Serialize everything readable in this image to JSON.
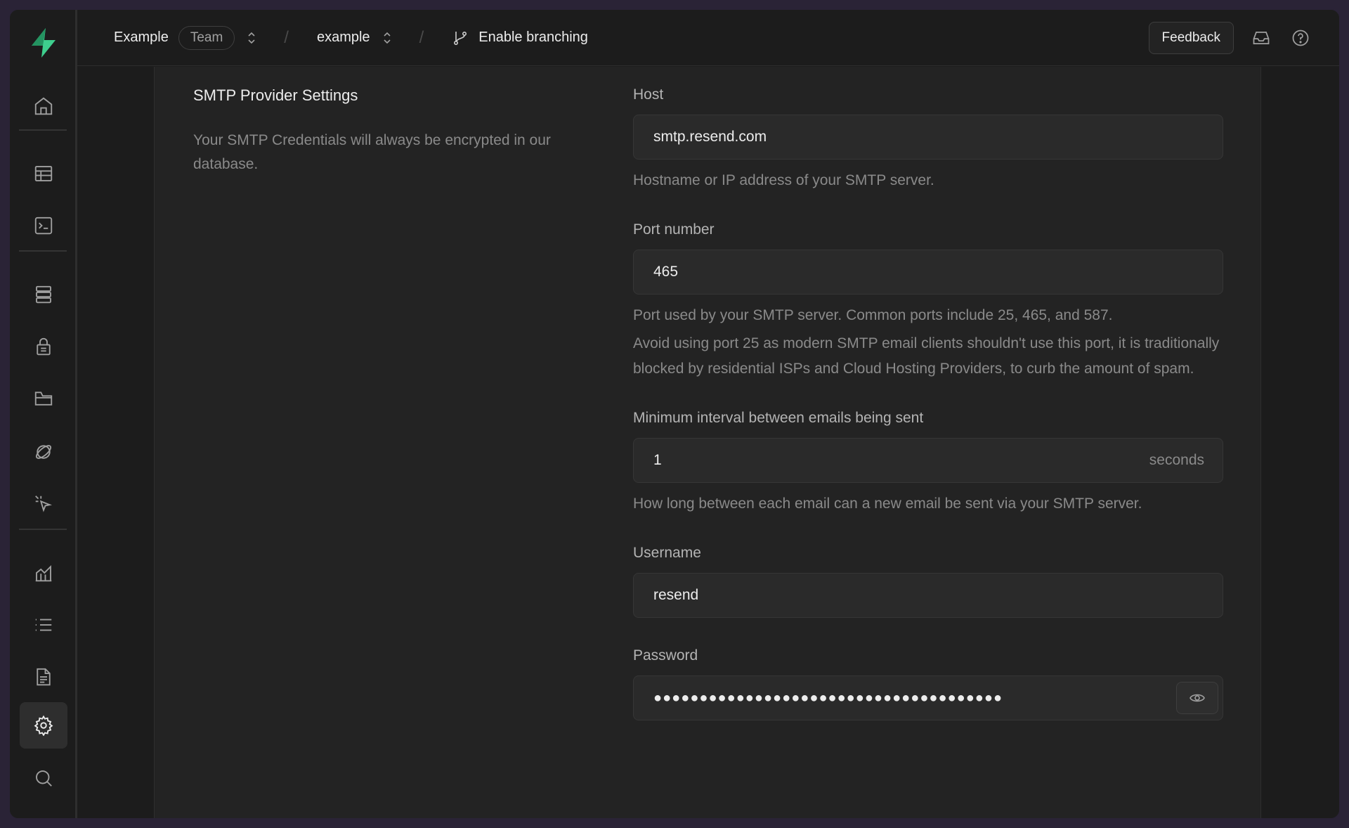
{
  "header": {
    "org_name": "Example",
    "org_badge": "Team",
    "project_name": "example",
    "branching_label": "Enable branching",
    "feedback_label": "Feedback"
  },
  "sidebar": {
    "items": [
      {
        "icon": "home-icon"
      },
      {
        "icon": "table-editor-icon"
      },
      {
        "icon": "sql-editor-icon"
      },
      {
        "icon": "database-icon"
      },
      {
        "icon": "authentication-icon"
      },
      {
        "icon": "storage-icon"
      },
      {
        "icon": "realtime-icon"
      },
      {
        "icon": "edge-functions-icon"
      },
      {
        "icon": "reports-icon"
      },
      {
        "icon": "logs-icon"
      },
      {
        "icon": "api-docs-icon"
      },
      {
        "icon": "settings-icon",
        "active": true
      },
      {
        "icon": "search-icon"
      }
    ]
  },
  "section": {
    "title": "SMTP Provider Settings",
    "description": "Your SMTP Credentials will always be encrypted in our database."
  },
  "fields": {
    "host": {
      "label": "Host",
      "value": "smtp.resend.com",
      "help": "Hostname or IP address of your SMTP server."
    },
    "port": {
      "label": "Port number",
      "value": "465",
      "help": "Port used by your SMTP server. Common ports include 25, 465, and 587.",
      "help2": "Avoid using port 25 as modern SMTP email clients shouldn't use this port, it is traditionally blocked by residential ISPs and Cloud Hosting Providers, to curb the amount of spam."
    },
    "interval": {
      "label": "Minimum interval between emails being sent",
      "value": "1",
      "suffix": "seconds",
      "help": "How long between each email can a new email be sent via your SMTP server."
    },
    "username": {
      "label": "Username",
      "value": "resend"
    },
    "password": {
      "label": "Password",
      "value": "●●●●●●●●●●●●●●●●●●●●●●●●●●●●●●●●●●●●●●"
    }
  },
  "colors": {
    "brand": "#3ecf8e",
    "background": "#1c1c1c",
    "panel": "#232323"
  }
}
